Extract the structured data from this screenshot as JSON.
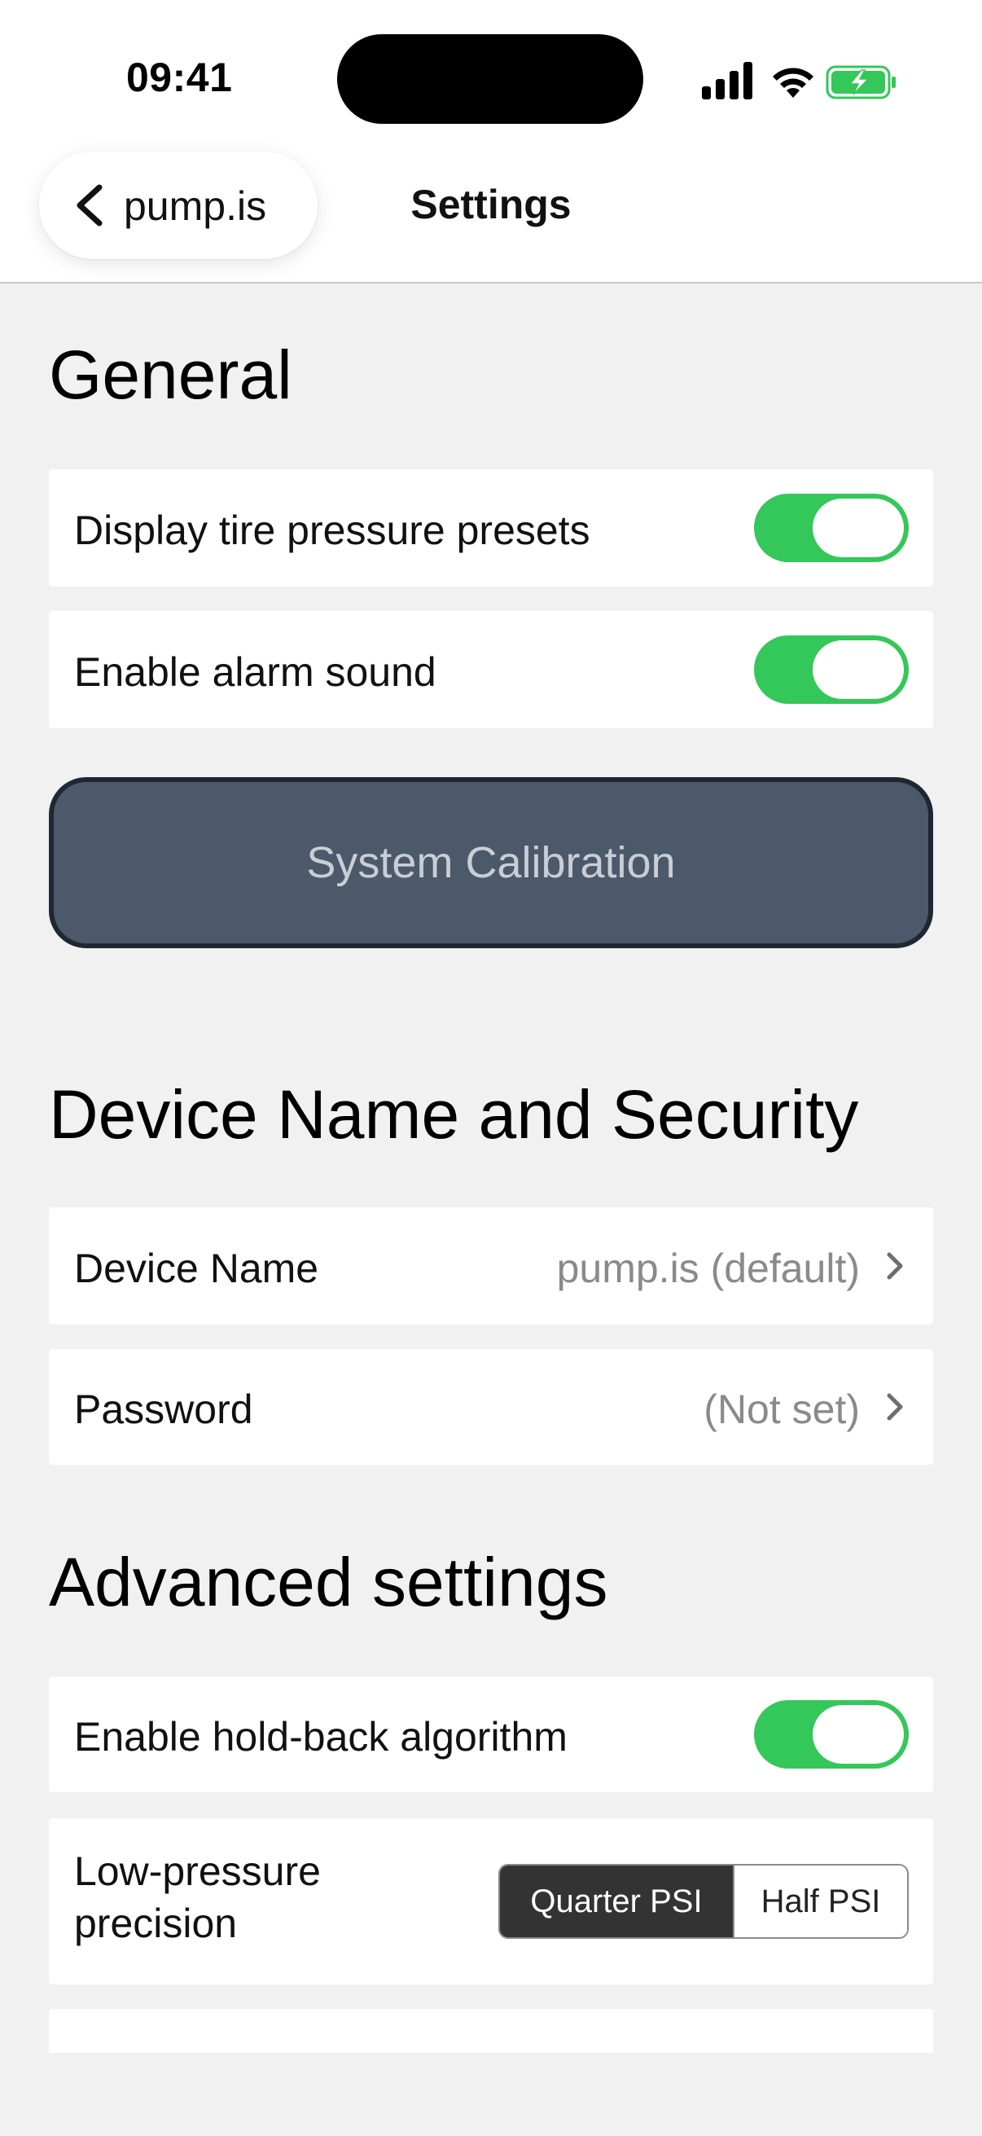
{
  "status_bar": {
    "time": "09:41"
  },
  "nav": {
    "back_label": "pump.is",
    "title": "Settings"
  },
  "general": {
    "title": "General",
    "rows": [
      {
        "label": "Display tire pressure presets",
        "on": true
      },
      {
        "label": "Enable alarm sound",
        "on": true
      }
    ],
    "calibration_button": "System Calibration"
  },
  "device": {
    "title": "Device Name and Security",
    "name_label": "Device Name",
    "name_value": "pump.is (default)",
    "password_label": "Password",
    "password_value": "(Not set)"
  },
  "advanced": {
    "title": "Advanced settings",
    "holdback_label": "Enable hold-back algorithm",
    "holdback_on": true,
    "precision_label_line1": "Low-pressure",
    "precision_label_line2": "precision",
    "precision_options": [
      "Quarter PSI",
      "Half PSI"
    ],
    "precision_selected": "Quarter PSI"
  },
  "colors": {
    "toggle_on": "#34c759",
    "calibration_bg": "#4b596b",
    "background": "#f1f1f1"
  },
  "icons": [
    "cellular-signal-icon",
    "wifi-icon",
    "battery-charging-icon",
    "chevron-left-icon",
    "chevron-right-icon"
  ]
}
